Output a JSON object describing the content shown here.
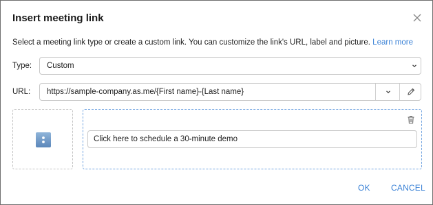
{
  "dialog": {
    "title": "Insert meeting link",
    "description": "Select a meeting link type or create a custom link. You can customize the link's URL, label and picture.",
    "learn_more": "Learn more"
  },
  "type_field": {
    "label": "Type:",
    "value": "Custom"
  },
  "url_field": {
    "label": "URL:",
    "value": "https://sample-company.as.me/{First name}-{Last name}"
  },
  "link_label": {
    "value": "Click here to schedule a 30-minute demo"
  },
  "footer": {
    "ok_label": "OK",
    "cancel_label": "CANCEL"
  },
  "colors": {
    "accent": "#3b82d6",
    "dashed_active": "#6fa2e0"
  },
  "icons": [
    "close-icon",
    "chevron-down-icon",
    "pencil-icon",
    "trash-icon",
    "picture-placeholder-icon"
  ]
}
